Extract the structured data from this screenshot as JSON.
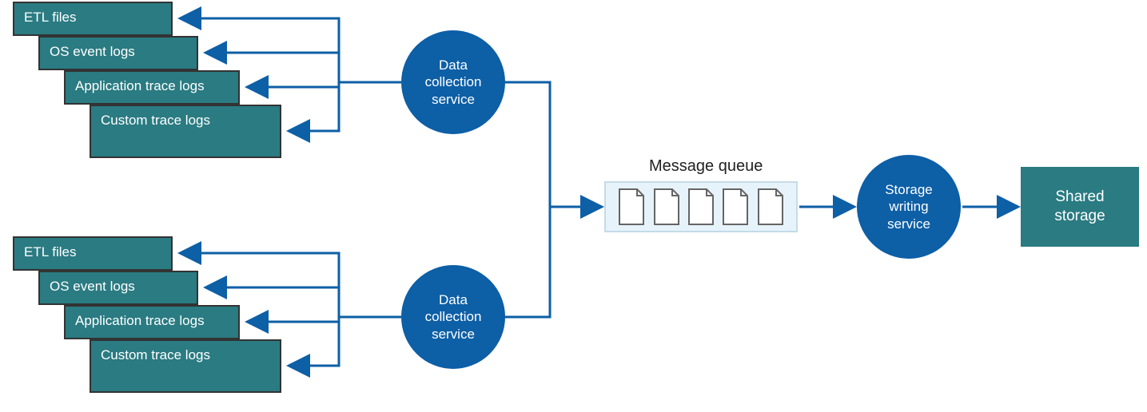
{
  "log_sources_top": {
    "items": [
      {
        "label": "ETL files"
      },
      {
        "label": "OS event logs"
      },
      {
        "label": "Application trace logs"
      },
      {
        "label": "Custom trace logs"
      }
    ]
  },
  "log_sources_bottom": {
    "items": [
      {
        "label": "ETL files"
      },
      {
        "label": "OS event logs"
      },
      {
        "label": "Application trace logs"
      },
      {
        "label": "Custom trace logs"
      }
    ]
  },
  "data_collection_top": {
    "label": "Data collection service"
  },
  "data_collection_bottom": {
    "label": "Data collection service"
  },
  "message_queue": {
    "label": "Message queue",
    "doc_count": 5
  },
  "storage_writing": {
    "label": "Storage writing service"
  },
  "shared_storage": {
    "label": "Shared storage"
  },
  "colors": {
    "teal_fill": "#2a7b82",
    "blue_fill": "#0d5fa6",
    "queue_bg": "#e7f3fa",
    "arrow": "#0d5fa6",
    "box_border": "#333"
  }
}
